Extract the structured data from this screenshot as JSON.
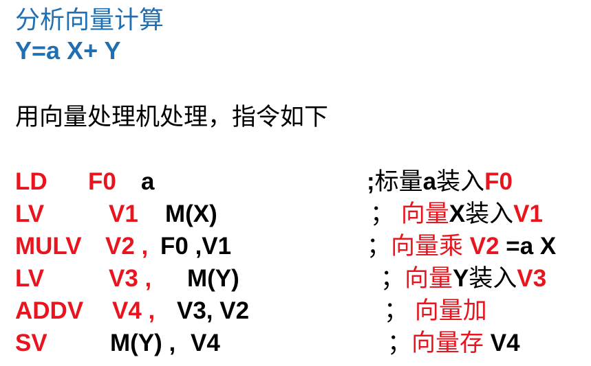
{
  "heading": {
    "title": "分析向量计算",
    "formula": "Y=a X+ Y"
  },
  "intro": "用向量处理机处理，指令如下",
  "colors": {
    "blue": "#1f6fb2",
    "red": "#e8141e",
    "black": "#000000"
  },
  "instructions": [
    {
      "op": "LD",
      "arg1": "F0",
      "arg2": "a",
      "comment": [
        {
          "t": ";",
          "c": "black"
        },
        {
          "t": "标量",
          "c": "black",
          "cjk": true
        },
        {
          "t": "a",
          "c": "black"
        },
        {
          "t": "装入",
          "c": "black",
          "cjk": true
        },
        {
          "t": "F0",
          "c": "red"
        }
      ]
    },
    {
      "op": "LV",
      "arg1": "V1",
      "arg2": "M(X)",
      "comment": [
        {
          "t": "；",
          "c": "black",
          "cjk": true
        },
        {
          "t": " ",
          "c": "black"
        },
        {
          "t": "向量",
          "c": "red",
          "cjk": true
        },
        {
          "t": "X",
          "c": "black"
        },
        {
          "t": "装入",
          "c": "black",
          "cjk": true
        },
        {
          "t": "V1",
          "c": "red"
        }
      ]
    },
    {
      "op": "MULV",
      "arg1": "V2 ,",
      "arg2": "F0 ,V1",
      "comment": [
        {
          "t": "；",
          "c": "black",
          "cjk": true
        },
        {
          "t": "向量乘",
          "c": "red",
          "cjk": true
        },
        {
          "t": "  V2 ",
          "c": "red"
        },
        {
          "t": "=a X",
          "c": "black"
        }
      ]
    },
    {
      "op": "LV",
      "arg1": "V3 ,",
      "arg2": "M(Y)",
      "comment": [
        {
          "t": "；",
          "c": "black",
          "cjk": true
        },
        {
          "t": "向量",
          "c": "red",
          "cjk": true
        },
        {
          "t": "Y",
          "c": "black"
        },
        {
          "t": "装入",
          "c": "black",
          "cjk": true
        },
        {
          "t": "V3",
          "c": "red"
        }
      ]
    },
    {
      "op": "ADDV",
      "arg1": "V4 ,",
      "arg2": "V3, V2",
      "comment": [
        {
          "t": "；",
          "c": "black",
          "cjk": true
        },
        {
          "t": " ",
          "c": "black"
        },
        {
          "t": "向量加",
          "c": "red",
          "cjk": true
        }
      ]
    },
    {
      "op": "SV",
      "arg1": "M(Y) ,",
      "arg2": "V4",
      "comment": [
        {
          "t": "；",
          "c": "black",
          "cjk": true
        },
        {
          "t": "向量存",
          "c": "red",
          "cjk": true
        },
        {
          "t": " V4",
          "c": "black"
        }
      ]
    }
  ]
}
